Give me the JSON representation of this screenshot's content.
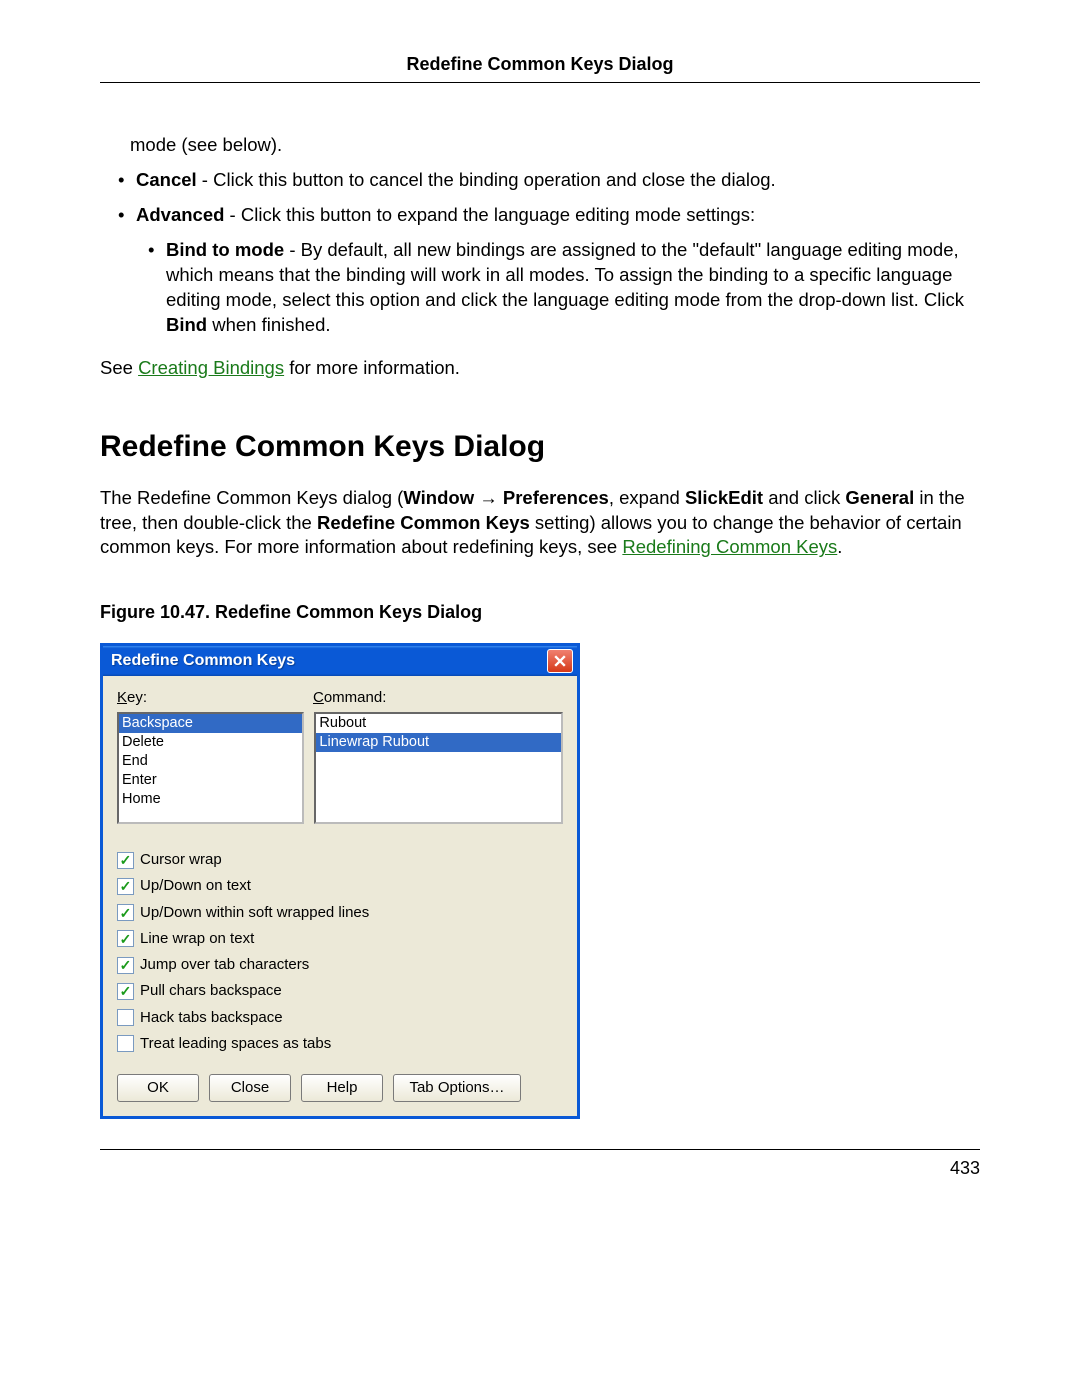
{
  "header": {
    "running_title": "Redefine Common Keys Dialog"
  },
  "footer": {
    "page_number": "433"
  },
  "body": {
    "mode_cont": "mode (see below).",
    "cancel_b": "Cancel",
    "cancel_rest": " - Click this button to cancel the binding operation and close the dialog.",
    "adv_b": "Advanced",
    "adv_rest": " - Click this button to expand the language editing mode settings:",
    "bindmode_b": "Bind to mode",
    "bindmode_mid": " - By default, all new bindings are assigned to the \"default\" language editing mode, which means that the binding will work in all modes. To assign the binding to a specific language editing mode, select this option and click the language editing mode from the drop-down list. Click ",
    "bindmode_b2": "Bind",
    "bindmode_end": " when finished.",
    "see_pre": "See ",
    "see_link": "Creating Bindings",
    "see_post": " for more information.",
    "h2": "Redefine Common Keys Dialog",
    "intro_pre": "The Redefine Common Keys dialog (",
    "intro_b1": "Window",
    "intro_arrow": " → ",
    "intro_b2": "Preferences",
    "intro_mid1": ", expand ",
    "intro_b3": "SlickEdit",
    "intro_mid2": " and click ",
    "intro_b4": "General",
    "intro_mid3": " in the tree, then double-click the ",
    "intro_b5": "Redefine Common Keys",
    "intro_mid4": " setting) allows you to change the behavior of certain common keys. For more information about redefining keys, see ",
    "intro_link": "Redefining Common Keys",
    "intro_end": ".",
    "fig_caption": "Figure 10.47. Redefine Common Keys Dialog"
  },
  "dialog": {
    "title": "Redefine Common Keys",
    "key_label_u": "K",
    "key_label_rest": "ey:",
    "cmd_label_u": "C",
    "cmd_label_rest": "ommand:",
    "keys": [
      {
        "label": "Backspace",
        "selected": true
      },
      {
        "label": "Delete",
        "selected": false
      },
      {
        "label": "End",
        "selected": false
      },
      {
        "label": "Enter",
        "selected": false
      },
      {
        "label": "Home",
        "selected": false
      }
    ],
    "commands": [
      {
        "label": "Rubout",
        "selected": false
      },
      {
        "label": "Linewrap Rubout",
        "selected": true
      }
    ],
    "checkboxes": [
      {
        "label": "Cursor wrap",
        "checked": true
      },
      {
        "label": "Up/Down on text",
        "checked": true
      },
      {
        "label": "Up/Down within soft wrapped lines",
        "checked": true
      },
      {
        "label": "Line wrap on text",
        "checked": true
      },
      {
        "label": "Jump over tab characters",
        "checked": true
      },
      {
        "label": "Pull chars backspace",
        "checked": true
      },
      {
        "label": "Hack tabs backspace",
        "checked": false
      },
      {
        "label": "Treat leading spaces as tabs",
        "checked": false
      }
    ],
    "buttons": {
      "ok": "OK",
      "close": "Close",
      "help": "Help",
      "tab_options": "Tab Options…"
    }
  }
}
